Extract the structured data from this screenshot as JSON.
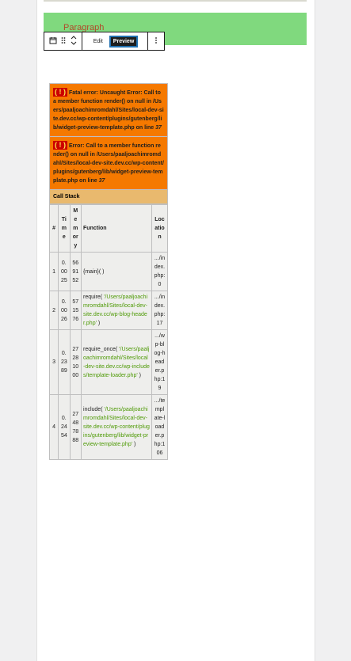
{
  "block": {
    "label": "Paragraph"
  },
  "toolbar": {
    "edit_label": "Edit",
    "preview_label": "Preview"
  },
  "errors": [
    {
      "badge": "( ! )",
      "text": "Fatal error: Uncaught Error: Call to a member function render() on null in /Users/paaljoachimromdahl/Sites/local-dev-site.dev.cc/wp-content/plugins/gutenberg/lib/widget-preview-template.php on line ",
      "line": "37"
    },
    {
      "badge": "( ! )",
      "text": "Error: Call to a member function render() on null in /Users/paaljoachimromdahl/Sites/local-dev-site.dev.cc/wp-content/plugins/gutenberg/lib/widget-preview-template.php on line ",
      "line": "37"
    }
  ],
  "callstack": {
    "title": "Call Stack",
    "headers": {
      "num": "#",
      "time": "Time",
      "memory": "Memory",
      "function": "Function",
      "location": "Location"
    },
    "rows": [
      {
        "num": "1",
        "time": "0.0025",
        "memory": "569152",
        "fn": "{main}( )",
        "arg": "",
        "fn_end": "",
        "loc": ".../index.php:0"
      },
      {
        "num": "2",
        "time": "0.0026",
        "memory": "571576",
        "fn": "require( ",
        "arg": "'/Users/paaljoachimromdahl/Sites/local-dev-site.dev.cc/wp-blog-header.php'",
        "fn_end": " )",
        "loc": ".../index.php:17"
      },
      {
        "num": "3",
        "time": "0.2389",
        "memory": "27281000",
        "fn": "require_once( ",
        "arg": "'/Users/paaljoachimromdahl/Sites/local-dev-site.dev.cc/wp-includes/template-loader.php'",
        "fn_end": " )",
        "loc": ".../wp-blog-header.php:19"
      },
      {
        "num": "4",
        "time": "0.2454",
        "memory": "27487888",
        "fn": "include( ",
        "arg": "'/Users/paaljoachimromdahl/Sites/local-dev-site.dev.cc/wp-content/plugins/gutenberg/lib/widget-preview-template.php'",
        "fn_end": " )",
        "loc": ".../template-loader.php:106"
      }
    ]
  }
}
